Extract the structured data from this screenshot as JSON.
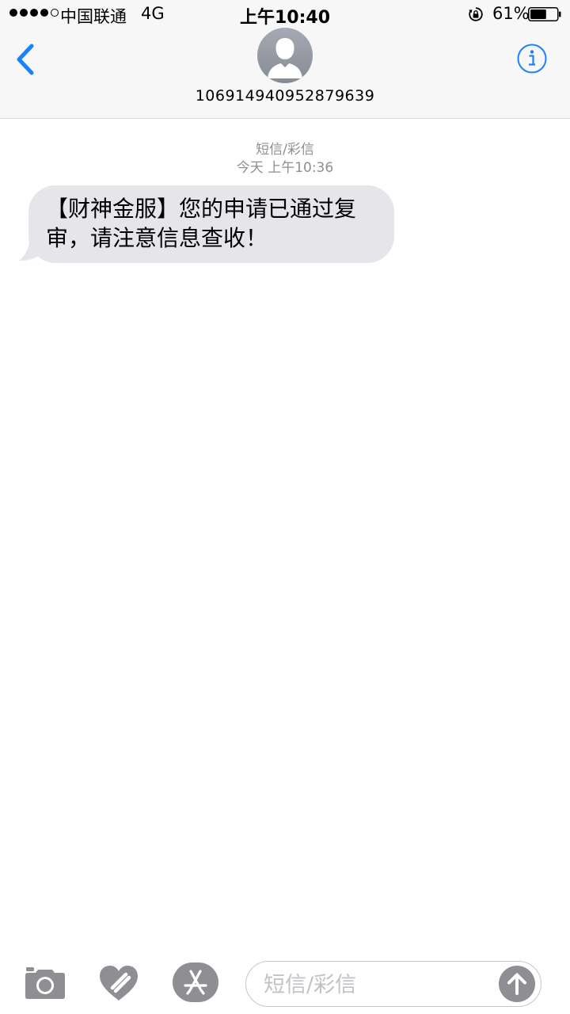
{
  "status_bar": {
    "carrier": "中国联通",
    "network": "4G",
    "time": "上午10:40",
    "battery_percent": "61%",
    "battery_level": 0.61,
    "signal_bars_filled": 4,
    "signal_bars_total": 5
  },
  "nav": {
    "back_icon": "chevron-left-icon",
    "contact_number": "106914940952879639",
    "info_icon": "info-icon",
    "accent_color": "#1a82fb"
  },
  "conversation": {
    "service_label": "短信/彩信",
    "timestamp": "今天 上午10:36",
    "messages": [
      {
        "direction": "incoming",
        "text": "【财神金服】您的申请已通过复审，请注意信息查收！",
        "bubble_color": "#e5e5ea"
      }
    ]
  },
  "input_bar": {
    "placeholder": "短信/彩信",
    "icons": [
      "camera-icon",
      "digital-touch-icon",
      "app-store-icon",
      "send-arrow-icon"
    ]
  }
}
